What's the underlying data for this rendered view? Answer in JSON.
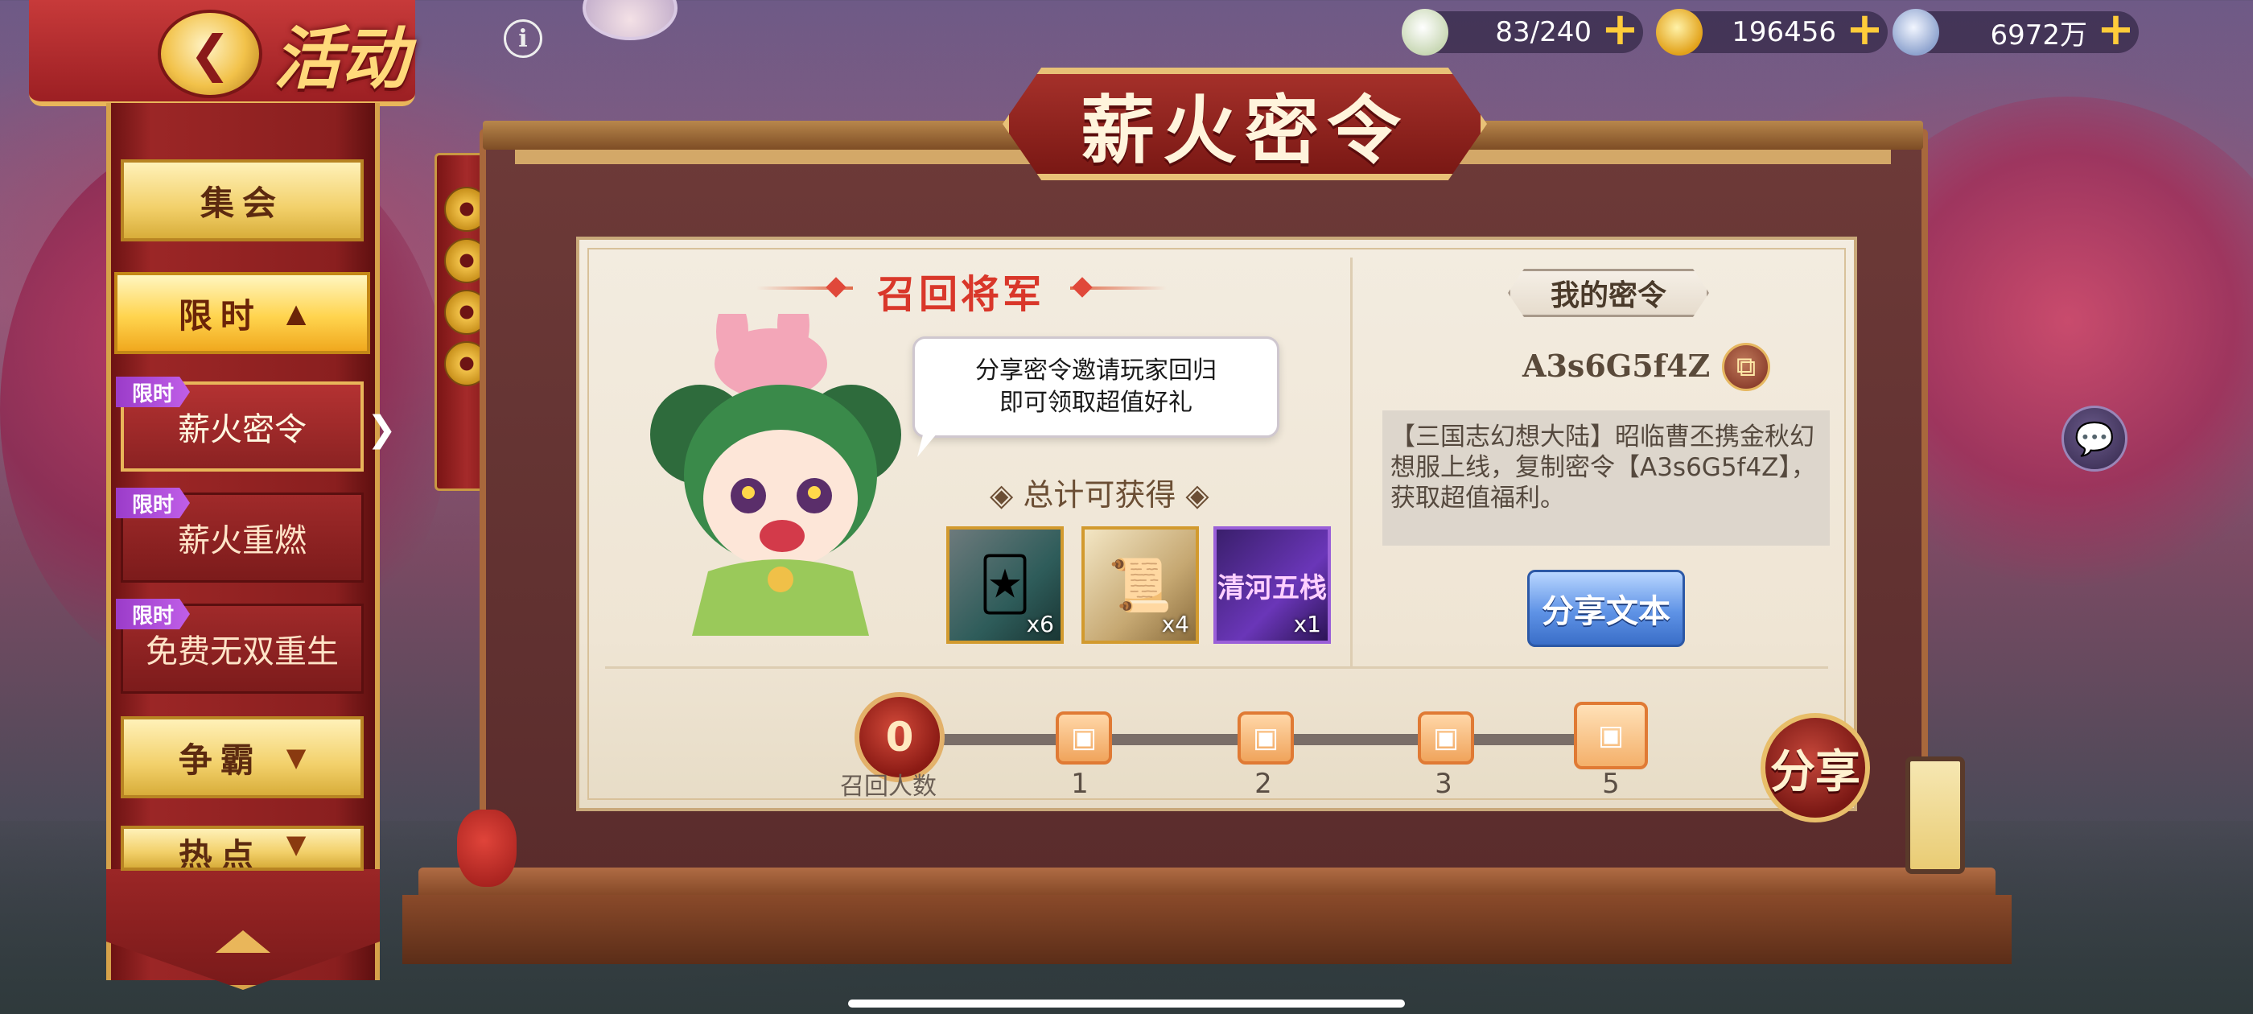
{
  "header": {
    "back_icon": "back-arrow-icon",
    "title": "活动",
    "info_icon": "info-icon"
  },
  "resources": [
    {
      "icon": "bun-icon",
      "value": "83/240"
    },
    {
      "icon": "gold-ingot-icon",
      "value": "196456"
    },
    {
      "icon": "silver-coin-icon",
      "value": "6972万"
    }
  ],
  "sidebar": {
    "tabs": [
      {
        "label": "集会",
        "state": "collapsed"
      },
      {
        "label": "限时",
        "state": "expanded"
      },
      {
        "label": "争霸",
        "state": "collapsed"
      },
      {
        "label": "热点",
        "state": "collapsed"
      }
    ],
    "sub_items": [
      {
        "label": "薪火密令",
        "badge": "限时",
        "active": true
      },
      {
        "label": "薪火重燃",
        "badge": "限时",
        "active": false
      },
      {
        "label": "免费无双重生",
        "badge": "限时",
        "active": false
      }
    ]
  },
  "board": {
    "title": "薪火密令",
    "recall_title": "召回将军",
    "speech_line1": "分享密令邀请玩家回归",
    "speech_line2": "即可领取超值好礼",
    "total_label": "总计可获得",
    "rewards": [
      {
        "icon": "jade-card-icon",
        "qty": "x6"
      },
      {
        "icon": "scroll-map-icon",
        "qty": "x4"
      },
      {
        "icon": "purple-item-icon",
        "name": "清河五栈",
        "qty": "x1"
      }
    ],
    "my_code_label": "我的密令",
    "code": "A3s6G5f4Z",
    "copy_icon": "copy-icon",
    "description": "【三国志幻想大陆】昭临曹丕携金秋幻想服上线，复制密令【A3s6G5f4Z】，获取超值福利。",
    "share_text_button": "分享文本",
    "progress": {
      "count": "0",
      "count_label": "召回人数",
      "milestones": [
        "1",
        "2",
        "3",
        "5"
      ]
    },
    "share_button": "分享"
  },
  "colors": {
    "accent_red": "#d9372a",
    "gold": "#e9b65a",
    "panel_bg": "#f3ece0",
    "limited_badge": "#9b3cc9",
    "share_blue": "#5f93e6"
  }
}
